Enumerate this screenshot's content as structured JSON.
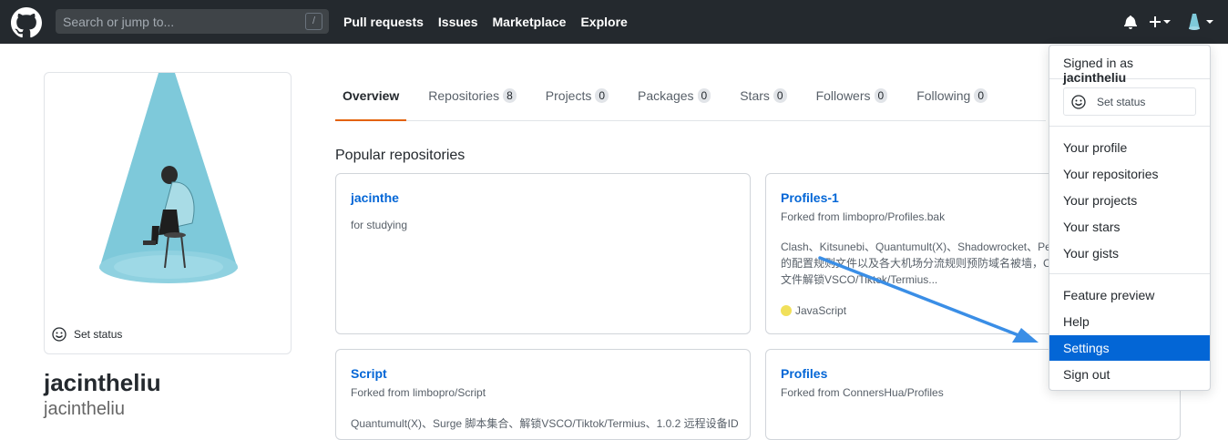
{
  "header": {
    "search_placeholder": "Search or jump to...",
    "search_shortcut": "/",
    "nav": [
      "Pull requests",
      "Issues",
      "Marketplace",
      "Explore"
    ],
    "icons": [
      "bell-icon",
      "plus-icon",
      "avatar"
    ]
  },
  "profile": {
    "set_status": "Set status",
    "fullname": "jacintheliu",
    "username": "jacintheliu"
  },
  "tabs": [
    {
      "label": "Overview",
      "count": null
    },
    {
      "label": "Repositories",
      "count": "8"
    },
    {
      "label": "Projects",
      "count": "0"
    },
    {
      "label": "Packages",
      "count": "0"
    },
    {
      "label": "Stars",
      "count": "0"
    },
    {
      "label": "Followers",
      "count": "0"
    },
    {
      "label": "Following",
      "count": "0"
    }
  ],
  "popular_title": "Popular repositories",
  "repos": [
    {
      "name": "jacinthe",
      "desc": "for studying"
    },
    {
      "name": "Profiles-1",
      "fork": "Forked from limbopro/Profiles.bak",
      "desc_lines": [
        "Clash、Kitsunebi、Quantumult(X)、Shadowrocket、Pep",
        "的配置规则文件以及各大机场分流规则预防域名被墙，C",
        "文件解锁VSCO/Tiktok/Termius..."
      ],
      "language": "JavaScript",
      "language_color": "#f1e05a"
    },
    {
      "name": "Script",
      "fork": "Forked from limbopro/Script",
      "desc": "Quantumult(X)、Surge 脚本集合、解锁VSCO/Tiktok/Termius、1.0.2 远程设备ID"
    },
    {
      "name": "Profiles",
      "fork": "Forked from ConnersHua/Profiles"
    }
  ],
  "dropdown": {
    "signed_in_prefix": "Signed in as",
    "signed_in_user": "jacintheliu",
    "set_status": "Set status",
    "group1": [
      "Your profile",
      "Your repositories",
      "Your projects",
      "Your stars",
      "Your gists"
    ],
    "group2": [
      "Feature preview",
      "Help",
      "Settings",
      "Sign out"
    ],
    "active_item": "Settings"
  },
  "colors": {
    "header_bg": "#24292e",
    "accent": "#0366d6",
    "tab_underline": "#e36209",
    "arrow": "#3a8ee6"
  }
}
